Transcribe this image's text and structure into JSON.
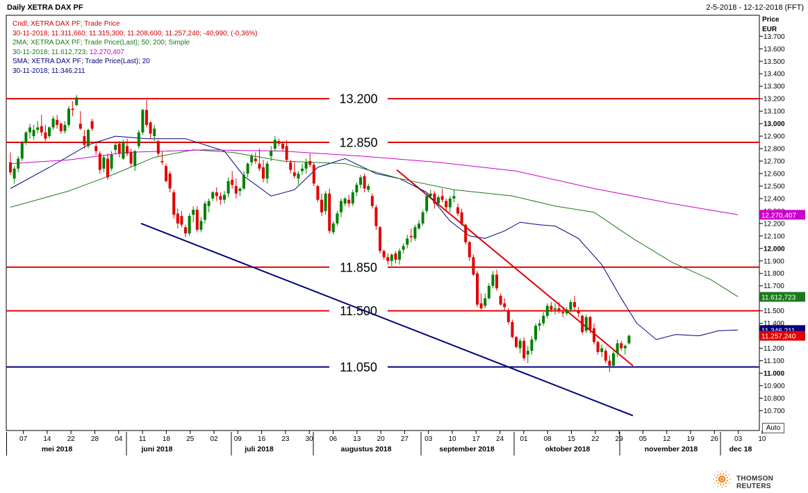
{
  "header": {
    "title": "Daily XETRA DAX PF",
    "date_range": "2-5-2018 - 12-12-2018 (FFT)"
  },
  "legend": [
    {
      "text": "Cndl; XETRA DAX PF; Trade Price",
      "color": "#d40000"
    },
    {
      "text": "30-11-2018; 11.311,660; 11.315,300; 11.208,600; 11.257,240; -40,990; (-0,36%)",
      "color": "#d40000"
    },
    {
      "text": "2MA; XETRA DAX PF; Trade Price(Last);  50;  200; Simple",
      "color": "#1a7a1a"
    },
    {
      "text": "30-11-2018; 11.612,723;",
      "color": "#1a7a1a",
      "extra": " 12.270,407",
      "extra_color": "#cc00cc"
    },
    {
      "text": "SMA; XETRA DAX PF; Trade Price(Last);  20",
      "color": "#000080"
    },
    {
      "text": "30-11-2018; 11.346,211",
      "color": "#000080"
    }
  ],
  "axis": {
    "price_label": "Price",
    "currency_label": "EUR",
    "auto_button": "Auto"
  },
  "brand": {
    "name": "THOMSON REUTERS"
  },
  "chart_data": {
    "type": "candlestick",
    "title": "Daily XETRA DAX PF",
    "ylabel": "Price EUR",
    "ylim": [
      10600,
      13800
    ],
    "y_ticks": [
      "10.700",
      "10.800",
      "10.900",
      "11.000",
      "11.100",
      "11.200",
      "11.300",
      "11.400",
      "11.500",
      "11.600",
      "11.700",
      "11.800",
      "11.900",
      "12.000",
      "12.100",
      "12.200",
      "12.300",
      "12.400",
      "12.500",
      "12.600",
      "12.700",
      "12.800",
      "12.900",
      "13.000",
      "13.100",
      "13.200",
      "13.300",
      "13.400",
      "13.500",
      "13.600",
      "13.700"
    ],
    "y_major": [
      "11.000",
      "12.000",
      "13.000"
    ],
    "day_ticks": [
      "07",
      "14",
      "22",
      "28",
      "04",
      "11",
      "18",
      "25",
      "02",
      "09",
      "16",
      "23",
      "30",
      "06",
      "13",
      "20",
      "27",
      "03",
      "10",
      "17",
      "24",
      "01",
      "08",
      "15",
      "22",
      "29",
      "05",
      "12",
      "19",
      "26",
      "03",
      "10"
    ],
    "month_labels": [
      "mei 2018",
      "juni 2018",
      "juli 2018",
      "augustus 2018",
      "september 2018",
      "oktober 2018",
      "november 2018",
      "dec 18"
    ],
    "levels": [
      {
        "label": "13.200",
        "value": 13200,
        "color": "#e00000"
      },
      {
        "label": "12.850",
        "value": 12850,
        "color": "#e00000"
      },
      {
        "label": "11.850",
        "value": 11850,
        "color": "#e00000"
      },
      {
        "label": "11.500",
        "value": 11500,
        "color": "#e00000"
      },
      {
        "label": "11.050",
        "value": 11050,
        "color": "#000080"
      }
    ],
    "trendlines": [
      {
        "color": "#e00000",
        "from": [
          "2018-09-18",
          12630
        ],
        "to": [
          "2018-12-12",
          11060
        ]
      },
      {
        "color": "#000080",
        "from": [
          "2018-06-18",
          12200
        ],
        "to": [
          "2018-12-12",
          10660
        ]
      }
    ],
    "series": [
      {
        "name": "SMA 20",
        "color": "#000080",
        "last": "11.346,211",
        "points": [
          [
            0,
            12480
          ],
          [
            10,
            12650
          ],
          [
            20,
            12830
          ],
          [
            27,
            12900
          ],
          [
            35,
            12880
          ],
          [
            45,
            12880
          ],
          [
            55,
            12780
          ],
          [
            60,
            12580
          ],
          [
            67,
            12420
          ],
          [
            73,
            12470
          ],
          [
            79,
            12650
          ],
          [
            86,
            12720
          ],
          [
            94,
            12600
          ],
          [
            100,
            12560
          ],
          [
            107,
            12450
          ],
          [
            113,
            12220
          ],
          [
            118,
            12100
          ],
          [
            122,
            12080
          ],
          [
            127,
            12140
          ],
          [
            131,
            12210
          ],
          [
            136,
            12190
          ],
          [
            140,
            12180
          ],
          [
            146,
            12080
          ],
          [
            152,
            11870
          ],
          [
            157,
            11600
          ],
          [
            161,
            11400
          ],
          [
            166,
            11270
          ],
          [
            171,
            11310
          ],
          [
            177,
            11300
          ],
          [
            182,
            11340
          ],
          [
            187,
            11346
          ]
        ]
      },
      {
        "name": "MA 50",
        "color": "#1a7a1a",
        "last": "11.612,723",
        "points": [
          [
            0,
            12330
          ],
          [
            15,
            12460
          ],
          [
            27,
            12600
          ],
          [
            37,
            12730
          ],
          [
            47,
            12790
          ],
          [
            57,
            12770
          ],
          [
            70,
            12700
          ],
          [
            86,
            12680
          ],
          [
            100,
            12560
          ],
          [
            114,
            12470
          ],
          [
            129,
            12420
          ],
          [
            140,
            12340
          ],
          [
            150,
            12290
          ],
          [
            160,
            12080
          ],
          [
            170,
            11890
          ],
          [
            180,
            11750
          ],
          [
            187,
            11613
          ]
        ]
      },
      {
        "name": "MA 200",
        "color": "#cc00cc",
        "last": "12.270,407",
        "points": [
          [
            0,
            12680
          ],
          [
            15,
            12710
          ],
          [
            30,
            12770
          ],
          [
            50,
            12790
          ],
          [
            70,
            12780
          ],
          [
            90,
            12740
          ],
          [
            110,
            12690
          ],
          [
            130,
            12620
          ],
          [
            150,
            12480
          ],
          [
            170,
            12360
          ],
          [
            187,
            12270
          ]
        ]
      }
    ],
    "candles_ohlc": [
      [
        12690,
        12770,
        12590,
        12610
      ],
      [
        12560,
        12660,
        12520,
        12640
      ],
      [
        12640,
        12740,
        12610,
        12720
      ],
      [
        12720,
        12860,
        12700,
        12850
      ],
      [
        12850,
        12940,
        12830,
        12930
      ],
      [
        12930,
        13000,
        12880,
        12970
      ],
      [
        12900,
        12990,
        12870,
        12950
      ],
      [
        12950,
        13020,
        12920,
        12970
      ],
      [
        12980,
        13070,
        12900,
        12930
      ],
      [
        12930,
        12990,
        12860,
        12880
      ],
      [
        12900,
        12980,
        12880,
        12970
      ],
      [
        12970,
        13060,
        12950,
        13040
      ],
      [
        13030,
        13070,
        12960,
        12990
      ],
      [
        13000,
        13010,
        12920,
        12940
      ],
      [
        12940,
        13020,
        12920,
        12990
      ],
      [
        12990,
        13140,
        12970,
        13120
      ],
      [
        13120,
        13180,
        13060,
        13110
      ],
      [
        13150,
        13230,
        13140,
        13210
      ],
      [
        13000,
        13100,
        12950,
        12960
      ],
      [
        12900,
        12950,
        12800,
        12830
      ],
      [
        12820,
        12960,
        12800,
        12950
      ],
      [
        13020,
        13040,
        12940,
        12960
      ],
      [
        12820,
        12860,
        12750,
        12780
      ],
      [
        12760,
        12780,
        12600,
        12630
      ],
      [
        12640,
        12750,
        12610,
        12730
      ],
      [
        12720,
        12760,
        12550,
        12570
      ],
      [
        12640,
        12780,
        12620,
        12750
      ],
      [
        12790,
        12850,
        12760,
        12830
      ],
      [
        12840,
        12860,
        12730,
        12760
      ],
      [
        12720,
        12870,
        12710,
        12850
      ],
      [
        12820,
        12880,
        12740,
        12760
      ],
      [
        12770,
        12800,
        12650,
        12680
      ],
      [
        12660,
        12790,
        12620,
        12780
      ],
      [
        12820,
        12950,
        12800,
        12930
      ],
      [
        12930,
        13120,
        12910,
        13110
      ],
      [
        13110,
        13190,
        12970,
        12990
      ],
      [
        13010,
        13020,
        12880,
        12920
      ],
      [
        12900,
        12990,
        12860,
        12960
      ],
      [
        12860,
        12870,
        12740,
        12760
      ],
      [
        12700,
        12780,
        12670,
        12690
      ],
      [
        12660,
        12680,
        12530,
        12540
      ],
      [
        12600,
        12620,
        12450,
        12480
      ],
      [
        12450,
        12470,
        12240,
        12270
      ],
      [
        12280,
        12320,
        12160,
        12200
      ],
      [
        12260,
        12300,
        12170,
        12190
      ],
      [
        12170,
        12190,
        12090,
        12120
      ],
      [
        12120,
        12280,
        12100,
        12260
      ],
      [
        12270,
        12340,
        12210,
        12310
      ],
      [
        12310,
        12340,
        12130,
        12150
      ],
      [
        12150,
        12250,
        12130,
        12220
      ],
      [
        12230,
        12380,
        12200,
        12360
      ],
      [
        12340,
        12400,
        12290,
        12380
      ],
      [
        12400,
        12460,
        12380,
        12450
      ],
      [
        12450,
        12490,
        12380,
        12420
      ],
      [
        12420,
        12450,
        12350,
        12390
      ],
      [
        12390,
        12460,
        12360,
        12430
      ],
      [
        12440,
        12570,
        12410,
        12540
      ],
      [
        12550,
        12620,
        12480,
        12510
      ],
      [
        12500,
        12560,
        12400,
        12440
      ],
      [
        12460,
        12490,
        12420,
        12480
      ],
      [
        12480,
        12620,
        12470,
        12590
      ],
      [
        12600,
        12690,
        12570,
        12680
      ],
      [
        12690,
        12760,
        12660,
        12740
      ],
      [
        12720,
        12770,
        12680,
        12700
      ],
      [
        12680,
        12800,
        12620,
        12640
      ],
      [
        12650,
        12710,
        12530,
        12560
      ],
      [
        12560,
        12700,
        12520,
        12680
      ],
      [
        12740,
        12820,
        12700,
        12780
      ],
      [
        12800,
        12900,
        12780,
        12870
      ],
      [
        12860,
        12880,
        12820,
        12840
      ],
      [
        12840,
        12860,
        12780,
        12800
      ],
      [
        12820,
        12870,
        12690,
        12710
      ],
      [
        12690,
        12710,
        12600,
        12630
      ],
      [
        12610,
        12700,
        12560,
        12580
      ],
      [
        12560,
        12620,
        12510,
        12600
      ],
      [
        12620,
        12680,
        12590,
        12640
      ],
      [
        12640,
        12720,
        12600,
        12690
      ],
      [
        12700,
        12760,
        12650,
        12670
      ],
      [
        12670,
        12690,
        12500,
        12520
      ],
      [
        12500,
        12510,
        12370,
        12390
      ],
      [
        12390,
        12440,
        12260,
        12290
      ],
      [
        12300,
        12460,
        12270,
        12440
      ],
      [
        12440,
        12480,
        12120,
        12140
      ],
      [
        12130,
        12220,
        12110,
        12200
      ],
      [
        12200,
        12300,
        12180,
        12280
      ],
      [
        12290,
        12400,
        12250,
        12380
      ],
      [
        12360,
        12410,
        12340,
        12400
      ],
      [
        12390,
        12430,
        12330,
        12360
      ],
      [
        12360,
        12470,
        12340,
        12450
      ],
      [
        12450,
        12530,
        12420,
        12510
      ],
      [
        12510,
        12590,
        12480,
        12570
      ],
      [
        12580,
        12600,
        12450,
        12480
      ],
      [
        12470,
        12520,
        12450,
        12500
      ],
      [
        12420,
        12440,
        12320,
        12340
      ],
      [
        12330,
        12350,
        12150,
        12180
      ],
      [
        12170,
        12180,
        11960,
        11980
      ],
      [
        11980,
        11990,
        11910,
        11930
      ],
      [
        11930,
        11960,
        11870,
        11900
      ],
      [
        11900,
        11960,
        11860,
        11950
      ],
      [
        11960,
        11980,
        11880,
        11910
      ],
      [
        11910,
        12000,
        11870,
        11980
      ],
      [
        11990,
        12040,
        11960,
        12020
      ],
      [
        12030,
        12110,
        12000,
        12080
      ],
      [
        12100,
        12160,
        12050,
        12090
      ],
      [
        12080,
        12190,
        12060,
        12170
      ],
      [
        12160,
        12230,
        12150,
        12200
      ],
      [
        12200,
        12310,
        12180,
        12290
      ],
      [
        12300,
        12440,
        12280,
        12420
      ],
      [
        12420,
        12470,
        12400,
        12440
      ],
      [
        12440,
        12460,
        12320,
        12360
      ],
      [
        12360,
        12430,
        12340,
        12410
      ],
      [
        12420,
        12480,
        12370,
        12390
      ],
      [
        12380,
        12400,
        12300,
        12330
      ],
      [
        12330,
        12420,
        12290,
        12400
      ],
      [
        12400,
        12470,
        12370,
        12420
      ],
      [
        12330,
        12360,
        12260,
        12280
      ],
      [
        12290,
        12320,
        12180,
        12200
      ],
      [
        12190,
        12200,
        12030,
        12050
      ],
      [
        12050,
        12060,
        11900,
        11930
      ],
      [
        11930,
        11950,
        11780,
        11790
      ],
      [
        11800,
        11820,
        11530,
        11550
      ],
      [
        11560,
        11640,
        11510,
        11520
      ],
      [
        11540,
        11640,
        11520,
        11600
      ],
      [
        11600,
        11720,
        11590,
        11700
      ],
      [
        11700,
        11820,
        11680,
        11790
      ],
      [
        11790,
        11830,
        11660,
        11680
      ],
      [
        11620,
        11640,
        11540,
        11550
      ],
      [
        11560,
        11600,
        11500,
        11530
      ],
      [
        11500,
        11520,
        11390,
        11410
      ],
      [
        11410,
        11430,
        11280,
        11290
      ],
      [
        11290,
        11300,
        11200,
        11210
      ],
      [
        11200,
        11280,
        11160,
        11260
      ],
      [
        11260,
        11290,
        11100,
        11120
      ],
      [
        11150,
        11220,
        11080,
        11180
      ],
      [
        11180,
        11300,
        11150,
        11270
      ],
      [
        11270,
        11400,
        11250,
        11380
      ],
      [
        11380,
        11430,
        11340,
        11400
      ],
      [
        11400,
        11490,
        11380,
        11460
      ],
      [
        11460,
        11560,
        11440,
        11540
      ],
      [
        11540,
        11570,
        11490,
        11510
      ],
      [
        11510,
        11560,
        11470,
        11520
      ],
      [
        11520,
        11570,
        11480,
        11500
      ],
      [
        11490,
        11520,
        11450,
        11480
      ],
      [
        11480,
        11530,
        11460,
        11510
      ],
      [
        11510,
        11590,
        11490,
        11570
      ],
      [
        11570,
        11620,
        11500,
        11530
      ],
      [
        11500,
        11530,
        11450,
        11480
      ],
      [
        11460,
        11470,
        11310,
        11330
      ],
      [
        11340,
        11470,
        11320,
        11450
      ],
      [
        11450,
        11460,
        11320,
        11350
      ],
      [
        11360,
        11400,
        11230,
        11250
      ],
      [
        11250,
        11260,
        11150,
        11170
      ],
      [
        11170,
        11230,
        11130,
        11200
      ],
      [
        11180,
        11200,
        11080,
        11100
      ],
      [
        11100,
        11140,
        11010,
        11060
      ],
      [
        11060,
        11180,
        11040,
        11160
      ],
      [
        11160,
        11270,
        11130,
        11240
      ],
      [
        11240,
        11260,
        11180,
        11200
      ],
      [
        11200,
        11230,
        11150,
        11220
      ],
      [
        11240,
        11310,
        11230,
        11300
      ]
    ]
  }
}
